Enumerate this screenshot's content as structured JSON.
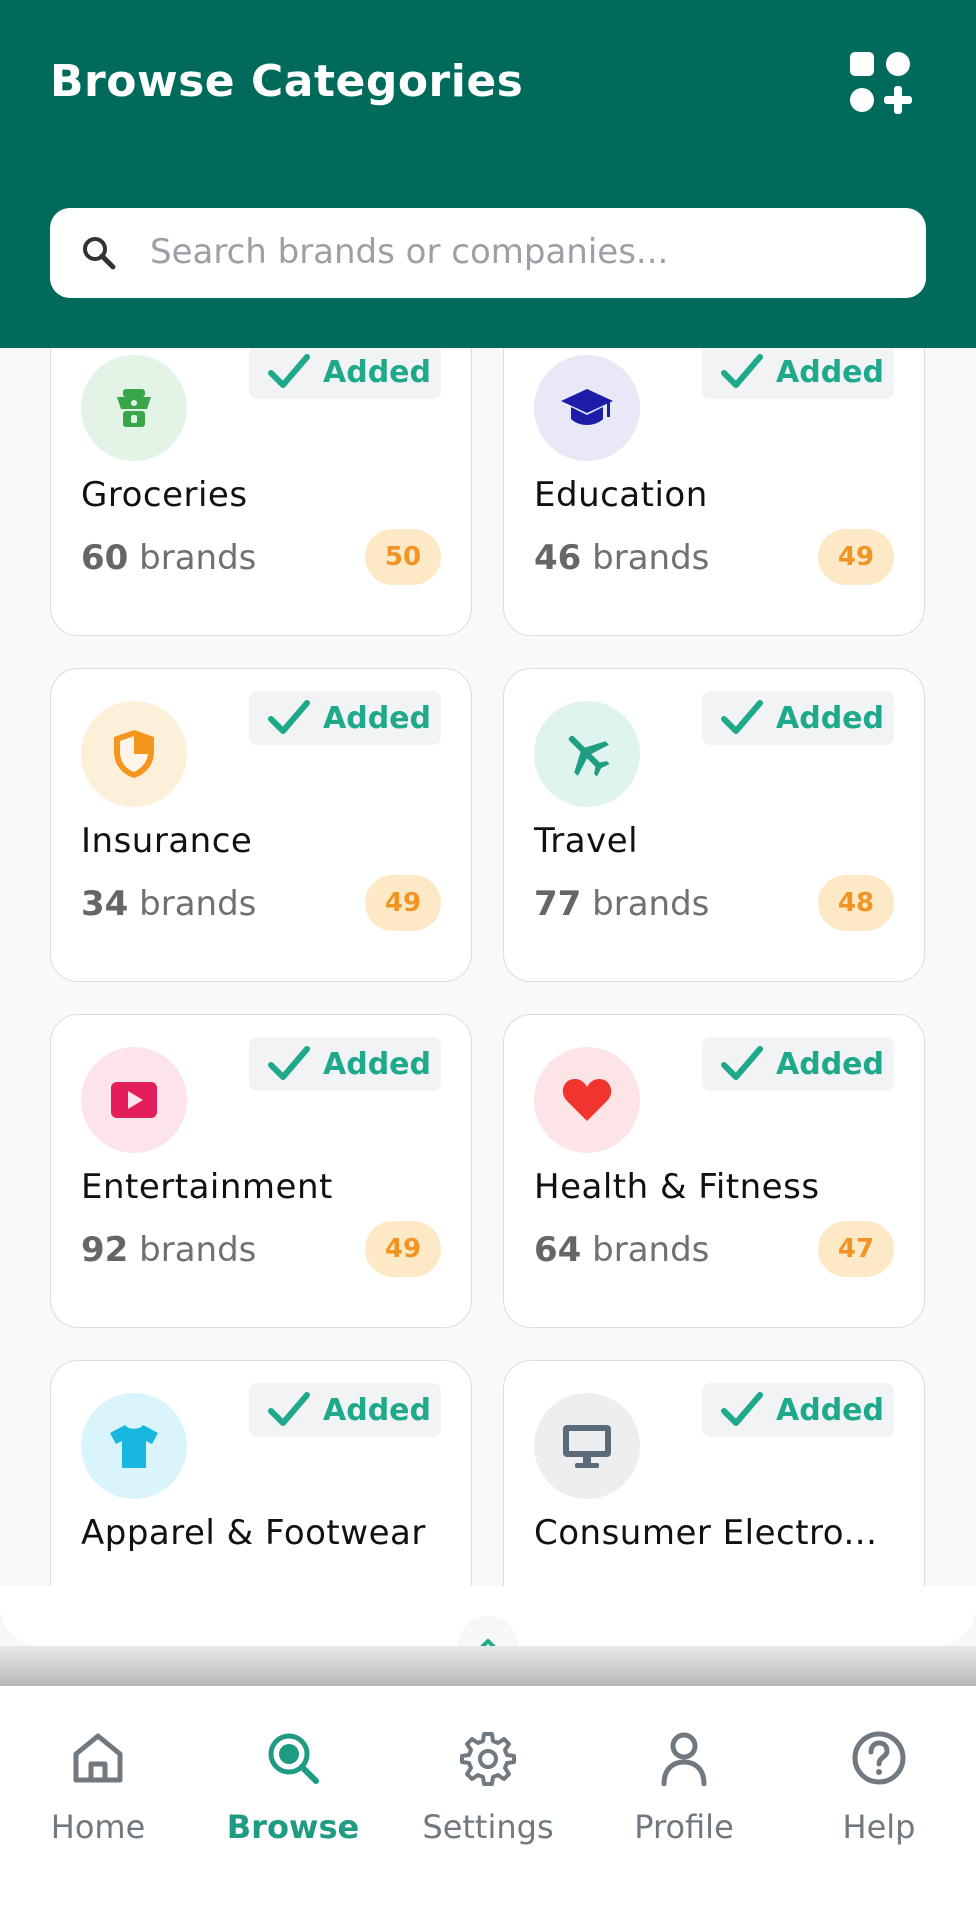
{
  "header": {
    "title": "Browse Categories",
    "action_icon": "add-widget-icon"
  },
  "search": {
    "placeholder": "Search brands or companies...",
    "icon": "search-icon"
  },
  "categories": [
    {
      "name": "Groceries",
      "brand_count": "60",
      "brands_suffix": " brands",
      "score": "50",
      "status": "Added",
      "icon": "basket-icon",
      "icon_bg": "#e3f4e6",
      "icon_color": "#3aa64a"
    },
    {
      "name": "Education",
      "brand_count": "46",
      "brands_suffix": " brands",
      "score": "49",
      "status": "Added",
      "icon": "graduation-cap-icon",
      "icon_bg": "#e8e8f6",
      "icon_color": "#1c1ca8"
    },
    {
      "name": "Insurance",
      "brand_count": "34",
      "brands_suffix": " brands",
      "score": "49",
      "status": "Added",
      "icon": "shield-icon",
      "icon_bg": "#fdf0d9",
      "icon_color": "#f4951e"
    },
    {
      "name": "Travel",
      "brand_count": "77",
      "brands_suffix": " brands",
      "score": "48",
      "status": "Added",
      "icon": "airplane-icon",
      "icon_bg": "#dff3ef",
      "icon_color": "#1e9e82"
    },
    {
      "name": "Entertainment",
      "brand_count": "92",
      "brands_suffix": " brands",
      "score": "49",
      "status": "Added",
      "icon": "play-icon",
      "icon_bg": "#fde3ea",
      "icon_color": "#e31e5a"
    },
    {
      "name": "Health & Fitness",
      "brand_count": "64",
      "brands_suffix": " brands",
      "score": "47",
      "status": "Added",
      "icon": "heart-icon",
      "icon_bg": "#fde4e6",
      "icon_color": "#f0352f"
    },
    {
      "name": "Apparel & Footwear",
      "brand_count": "",
      "brands_suffix": "",
      "score": "",
      "status": "Added",
      "icon": "tshirt-icon",
      "icon_bg": "#d9f4fb",
      "icon_color": "#17b7e0"
    },
    {
      "name": "Consumer Electro...",
      "brand_count": "",
      "brands_suffix": "",
      "score": "",
      "status": "Added",
      "icon": "monitor-icon",
      "icon_bg": "#eceef0",
      "icon_color": "#5a6a78"
    }
  ],
  "nav": {
    "items": [
      {
        "label": "Home",
        "icon": "home-icon",
        "active": false
      },
      {
        "label": "Browse",
        "icon": "browse-search-icon",
        "active": true
      },
      {
        "label": "Settings",
        "icon": "gear-icon",
        "active": false
      },
      {
        "label": "Profile",
        "icon": "user-icon",
        "active": false
      },
      {
        "label": "Help",
        "icon": "help-icon",
        "active": false
      }
    ]
  },
  "colors": {
    "header_bg": "#006b5b",
    "accent": "#1ea88c",
    "score_bg": "#fde9c6",
    "score_text": "#f29424"
  }
}
